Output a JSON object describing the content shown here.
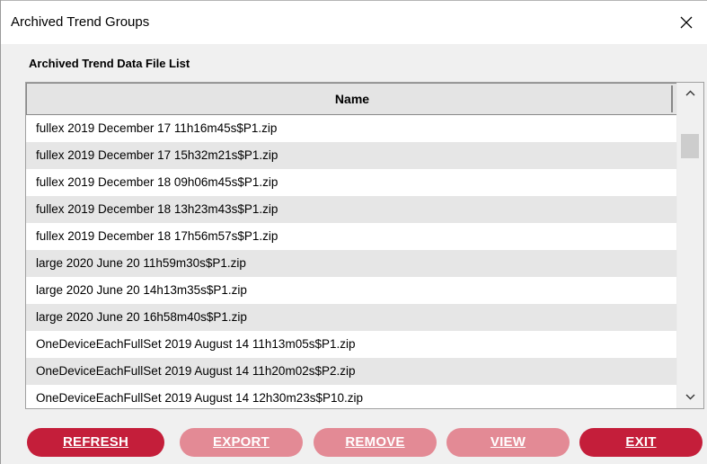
{
  "window": {
    "title": "Archived Trend Groups"
  },
  "section": {
    "label": "Archived Trend Data File List"
  },
  "table": {
    "column_header": "Name",
    "rows": [
      "fullex 2019 December 17 11h16m45s$P1.zip",
      "fullex 2019 December 17 15h32m21s$P1.zip",
      "fullex 2019 December 18 09h06m45s$P1.zip",
      "fullex 2019 December 18 13h23m43s$P1.zip",
      "fullex 2019 December 18 17h56m57s$P1.zip",
      "large 2020 June 20 11h59m30s$P1.zip",
      "large 2020 June 20 14h13m35s$P1.zip",
      "large 2020 June 20 16h58m40s$P1.zip",
      "OneDeviceEachFullSet 2019 August 14 11h13m05s$P1.zip",
      "OneDeviceEachFullSet 2019 August 14 11h20m02s$P2.zip",
      "OneDeviceEachFullSet 2019 August 14 12h30m23s$P10.zip"
    ]
  },
  "buttons": {
    "refresh": "REFRESH",
    "export": "EXPORT",
    "remove": "REMOVE",
    "view": "VIEW",
    "exit": "EXIT"
  },
  "icons": {
    "close": "close-icon",
    "scroll_up": "chevron-up-icon",
    "scroll_down": "chevron-down-icon"
  },
  "colors": {
    "button_active": "#c41e3a",
    "button_disabled": "#e38a95",
    "row_alt": "#e6e6e6",
    "header_bg": "#e4e4e4"
  }
}
